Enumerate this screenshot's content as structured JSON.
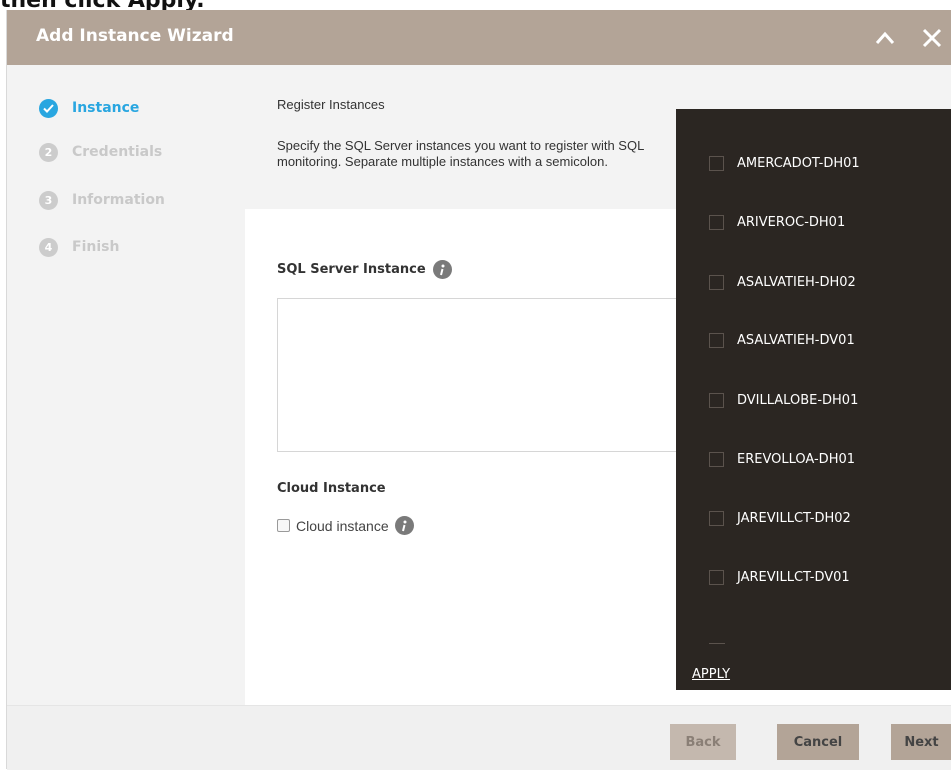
{
  "caption": "then click Apply.",
  "wizard": {
    "title": "Add Instance Wizard",
    "steps": [
      {
        "num": "",
        "label": "Instance"
      },
      {
        "num": "2",
        "label": "Credentials"
      },
      {
        "num": "3",
        "label": "Information"
      },
      {
        "num": "4",
        "label": "Finish"
      }
    ]
  },
  "main": {
    "section_title": "Register Instances",
    "description": "Specify the SQL Server instances you want to register with SQL monitoring. Separate multiple instances with a semicolon.",
    "sql_label": "SQL Server Instance",
    "cloud_heading": "Cloud Instance",
    "cloud_checkbox_label": "Cloud instance"
  },
  "dropdown": {
    "items": [
      "AMERCADOT-DH01",
      "ARIVEROC-DH01",
      "ASALVATIEH-DH02",
      "ASALVATIEH-DV01",
      "DVILLALOBE-DH01",
      "EREVOLLOA-DH01",
      "JAREVILLCT-DH02",
      "JAREVILLCT-DV01"
    ],
    "apply_label": "APPLY"
  },
  "footer": {
    "back": "Back",
    "cancel": "Cancel",
    "next": "Next"
  },
  "colors": {
    "titlebar": "#b3a497",
    "accent": "#29a6e0",
    "dropdown_bg": "#2b2622"
  },
  "icons": [
    "check-icon",
    "chevron-up-icon",
    "close-icon",
    "info-icon"
  ]
}
